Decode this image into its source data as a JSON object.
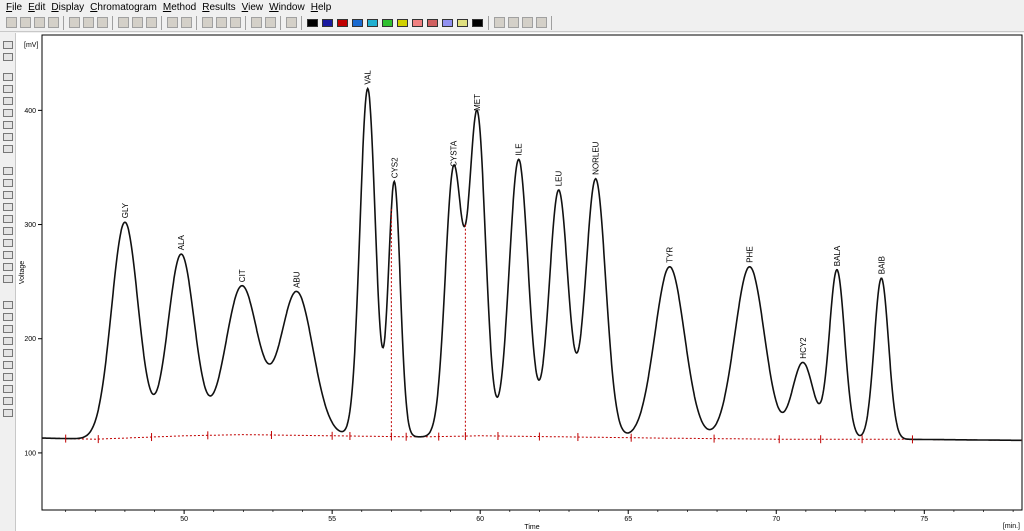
{
  "menu": {
    "items": [
      {
        "label": "File",
        "underline": "F",
        "rest": "ile"
      },
      {
        "label": "Edit",
        "underline": "E",
        "rest": "dit"
      },
      {
        "label": "Display",
        "underline": "D",
        "rest": "isplay"
      },
      {
        "label": "Chromatogram",
        "underline": "C",
        "rest": "hromatogram"
      },
      {
        "label": "Method",
        "underline": "M",
        "rest": "ethod"
      },
      {
        "label": "Results",
        "underline": "R",
        "rest": "esults"
      },
      {
        "label": "View",
        "underline": "V",
        "rest": "iew"
      },
      {
        "label": "Window",
        "underline": "W",
        "rest": "indow"
      },
      {
        "label": "Help",
        "underline": "H",
        "rest": "elp"
      }
    ]
  },
  "toolbar": {
    "icons": [
      "new-icon",
      "open-icon",
      "close-icon",
      "edit-icon",
      "print-icon",
      "print-preview-icon",
      "export-icon",
      "cut-icon",
      "copy-icon",
      "paste-icon",
      "undo-icon",
      "redo-icon",
      "zoom-in-icon",
      "zoom-out-icon",
      "zoom-fit-icon",
      "pencil-icon",
      "comment-icon",
      "peak-icon"
    ],
    "trace_colors": [
      "#000000",
      "#1a1aa0",
      "#c00000",
      "#1a6ad0",
      "#20b0d0",
      "#30c030",
      "#d0d000",
      "#f08080",
      "#d06060",
      "#9090f0",
      "#e0e080",
      "#000000"
    ],
    "nav_icons": [
      "first-icon",
      "prev-icon",
      "next-icon",
      "last-icon"
    ]
  },
  "chart_data": {
    "type": "line",
    "xlabel": "Time",
    "ylabel": "Voltage",
    "xunit": "[min.]",
    "yunit": "[mV]",
    "xlim": [
      45.2,
      78.3
    ],
    "ylim": [
      50,
      466
    ],
    "x_ticks": [
      50,
      55,
      60,
      65,
      70,
      75
    ],
    "y_ticks": [
      100,
      200,
      300,
      400
    ],
    "baseline": {
      "x": [
        45.2,
        47,
        50,
        52,
        55,
        58,
        60,
        63,
        66,
        70,
        74,
        78.3
      ],
      "y": [
        113,
        112,
        115,
        116,
        115,
        114,
        115,
        114,
        113,
        112,
        112,
        111
      ]
    },
    "peaks": [
      {
        "name": "GLY",
        "rt": 48.0,
        "height": 302,
        "width": 0.45
      },
      {
        "name": "ALA",
        "rt": 49.9,
        "height": 274,
        "width": 0.45
      },
      {
        "name": "CIT",
        "rt": 51.95,
        "height": 246,
        "width": 0.55
      },
      {
        "name": "ABU",
        "rt": 53.8,
        "height": 241,
        "width": 0.55
      },
      {
        "name": "VAL",
        "rt": 56.2,
        "height": 419,
        "width": 0.26
      },
      {
        "name": "CYS2",
        "rt": 57.1,
        "height": 337,
        "width": 0.2
      },
      {
        "name": "CYSTA",
        "rt": 59.1,
        "height": 347,
        "width": 0.28
      },
      {
        "name": "MET",
        "rt": 59.9,
        "height": 396,
        "width": 0.28
      },
      {
        "name": "ILE",
        "rt": 61.3,
        "height": 357,
        "width": 0.32
      },
      {
        "name": "LEU",
        "rt": 62.65,
        "height": 330,
        "width": 0.32
      },
      {
        "name": "NORLEU",
        "rt": 63.9,
        "height": 340,
        "width": 0.34
      },
      {
        "name": "TYR",
        "rt": 66.4,
        "height": 263,
        "width": 0.5
      },
      {
        "name": "PHE",
        "rt": 69.1,
        "height": 263,
        "width": 0.5
      },
      {
        "name": "HCY2",
        "rt": 70.9,
        "height": 179,
        "width": 0.36
      },
      {
        "name": "BALA",
        "rt": 72.05,
        "height": 260,
        "width": 0.26
      },
      {
        "name": "BAIB",
        "rt": 73.55,
        "height": 253,
        "width": 0.24
      }
    ],
    "integration_marks_x": [
      46.0,
      47.1,
      48.9,
      50.8,
      52.95,
      55.0,
      55.6,
      57.0,
      57.5,
      58.6,
      59.5,
      60.6,
      62.0,
      63.3,
      65.1,
      67.9,
      70.1,
      71.5,
      72.9,
      74.6
    ],
    "trace_color": "#111111",
    "baseline_color": "#c00000"
  }
}
